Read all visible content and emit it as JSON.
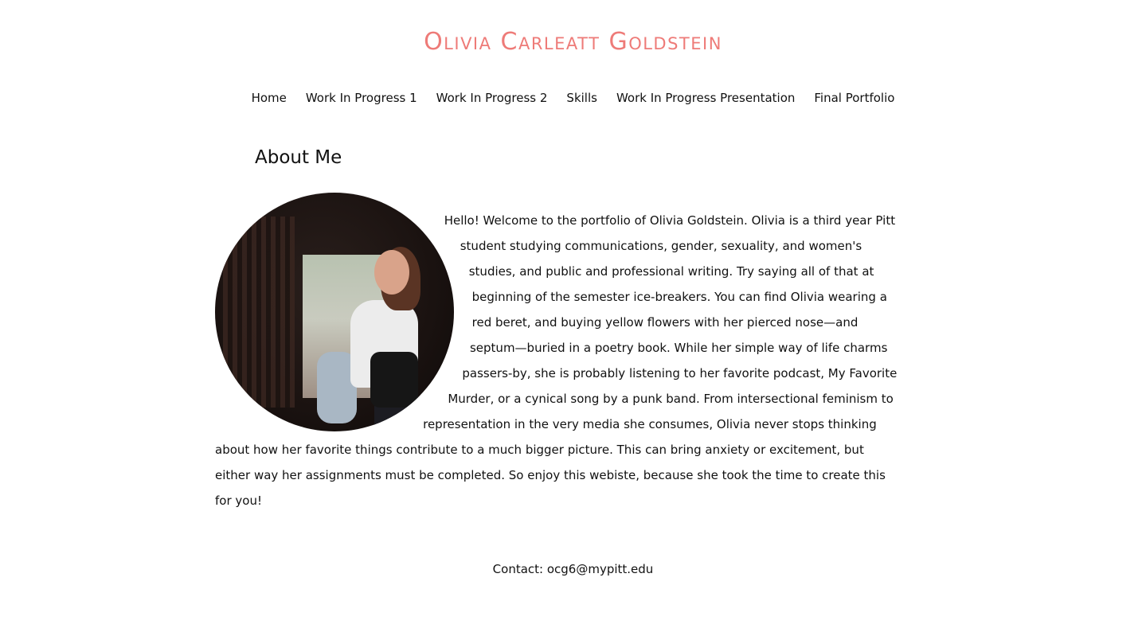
{
  "site": {
    "title": "Olivia Carleatt Goldstein",
    "title_color": "#ee7b78"
  },
  "nav": {
    "items": [
      {
        "label": "Home"
      },
      {
        "label": "Work In Progress 1"
      },
      {
        "label": "Work In Progress 2"
      },
      {
        "label": "Skills"
      },
      {
        "label": "Work In Progress Presentation"
      },
      {
        "label": "Final Portfolio"
      }
    ]
  },
  "main": {
    "heading": "About Me",
    "bio": "Hello! Welcome to the portfolio of Olivia Goldstein. Olivia is a third year Pitt student studying communications, gender, sexuality, and women's studies, and public and professional writing. Try saying all of that at beginning of the semester ice-breakers. You can find Olivia wearing a red beret, and buying yellow flowers with her pierced nose—and septum—buried in a poetry book. While her simple way of life charms passers-by, she is probably listening to her favorite podcast, My Favorite Murder, or a cynical song by a punk band. From intersectional feminism to representation in the very media she consumes, Olivia never stops thinking about how her favorite things contribute to a much bigger picture. This can bring anxiety or excitement, but either way her assignments must be completed. So enjoy this webiste, because she took the time to create this for you!",
    "photo_alt": "portrait-photo"
  },
  "footer": {
    "contact": "Contact: ocg6@mypitt.edu"
  }
}
